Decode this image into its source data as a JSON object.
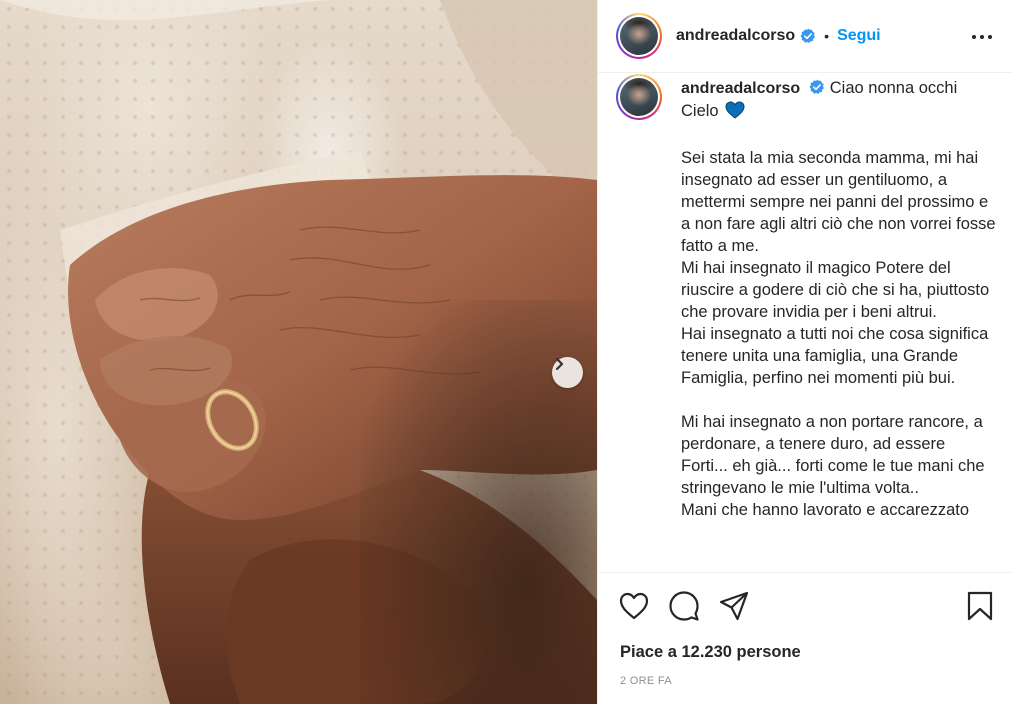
{
  "post": {
    "image": {
      "description_icon": "photo-hands-icon",
      "next_icon": "chevron-right-icon"
    },
    "header": {
      "username": "andreadalcorso",
      "separator": "•",
      "follow_label": "Segui",
      "verified_icon": "verified-badge-icon",
      "more_icon": "more-options-icon"
    },
    "caption": {
      "username": "andreadalcorso",
      "heading": "Ciao nonna occhi Cielo",
      "paragraphs": [
        "Sei stata la mia seconda mamma, mi hai insegnato ad esser un gentiluomo, a mettermi sempre nei panni del prossimo e a non fare agli altri ciò che non vorrei fosse fatto a me.",
        "Mi hai insegnato il magico Potere del riuscire a godere di ciò che si ha, piuttosto che provare invidia per i beni altrui.",
        "Hai insegnato a tutti noi che cosa significa tenere unita una famiglia, una Grande Famiglia, perfino nei momenti più bui.",
        "Mi hai insegnato a non portare rancore, a perdonare, a tenere duro, ad essere Forti... eh già... forti come le tue mani che stringevano le mie l'ultima volta..",
        "Mani che hanno lavorato e accarezzato"
      ]
    },
    "actions": {
      "like_icon": "heart-icon",
      "comment_icon": "comment-icon",
      "share_icon": "share-icon",
      "save_icon": "bookmark-icon"
    },
    "likes_text": "Piace a 12.230 persone",
    "timestamp": "2 ORE FA",
    "colors": {
      "link": "#0095f6",
      "verified": "#3897f0",
      "text": "#262626",
      "muted": "#8e8e8e",
      "heart_emoji": "#0b6fb8"
    }
  }
}
